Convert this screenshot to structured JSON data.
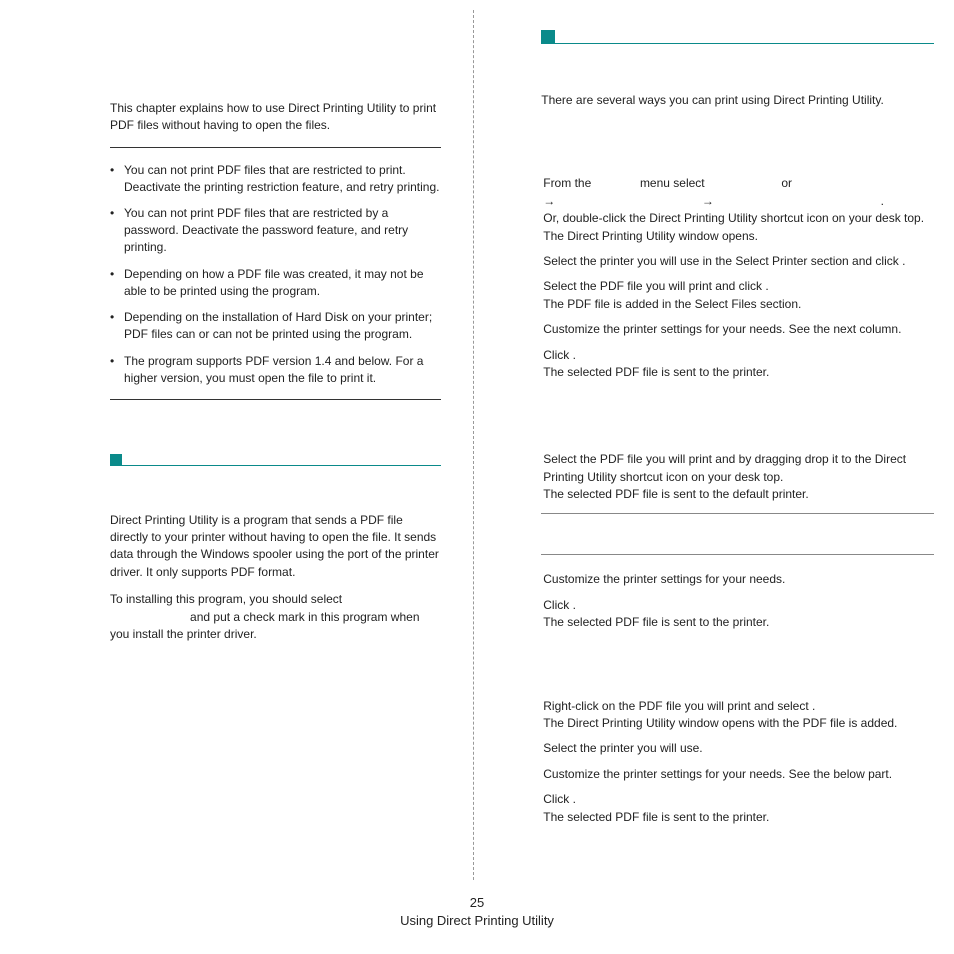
{
  "left": {
    "intro": "This chapter explains how to use Direct Printing Utility to print PDF files without having to open the files.",
    "bullets": [
      "You can not print PDF files that are restricted to print. Deactivate the printing restriction feature, and retry printing.",
      "You can not print PDF files that are restricted by a password. Deactivate the password feature, and retry printing.",
      "Depending on how a PDF file was created, it may not be able to be printed using the                                  program.",
      "Depending on the installation of Hard Disk on your printer; PDF files can or can not be printed using the                              program.",
      "The                                   program supports PDF version 1.4 and below. For a higher version, you must open the file to print it."
    ],
    "overview1": "Direct Printing Utility is a program that sends a PDF file directly to your printer without having to open the file. It sends data through the Windows spooler using the port of the printer driver. It only supports PDF format.",
    "overview2a": "To installing this program, you should select",
    "overview2b": "and put a check mark in this program when you install the printer driver."
  },
  "right": {
    "intro": "There are several ways you can print using Direct Printing Utility.",
    "win": {
      "s1_a": "From the",
      "s1_b": "menu select",
      "s1_c": "or",
      "s1_arrow": "→",
      "s1_end": ".",
      "s1_alt": "Or, double-click the Direct Printing Utility shortcut icon on your desk top.",
      "s1_opens": "The Direct Printing Utility window opens.",
      "s2": "Select the printer you will use in the Select Printer section and click           .",
      "s3": "Select the PDF file you will print and click           .",
      "s3_b": "The PDF file is added in the Select Files section.",
      "s4": "Customize the printer settings for your needs. See the next column.",
      "s5": "Click         .",
      "s5_b": "The selected PDF file is sent to the printer."
    },
    "short": {
      "s1": "Select the PDF file you will print and by dragging drop it to the Direct Printing Utility shortcut icon on your desk top.",
      "s1_b": "The selected PDF file is sent to the default printer."
    },
    "short2": {
      "s2": "Customize the printer settings for your needs.",
      "s3": "Click         .",
      "s3_b": "The selected PDF file is sent to the printer."
    },
    "rclick": {
      "s1": "Right-click on the PDF file you will print and select                          .",
      "s1_b": "The Direct Printing Utility window opens with the PDF file is added.",
      "s2": "Select the printer you will use.",
      "s3": "Customize the printer settings for your needs. See the below part.",
      "s4": "Click          .",
      "s4_b": "The selected PDF file is sent to the printer."
    }
  },
  "footer": {
    "num": "25",
    "title": "Using Direct Printing Utility"
  }
}
